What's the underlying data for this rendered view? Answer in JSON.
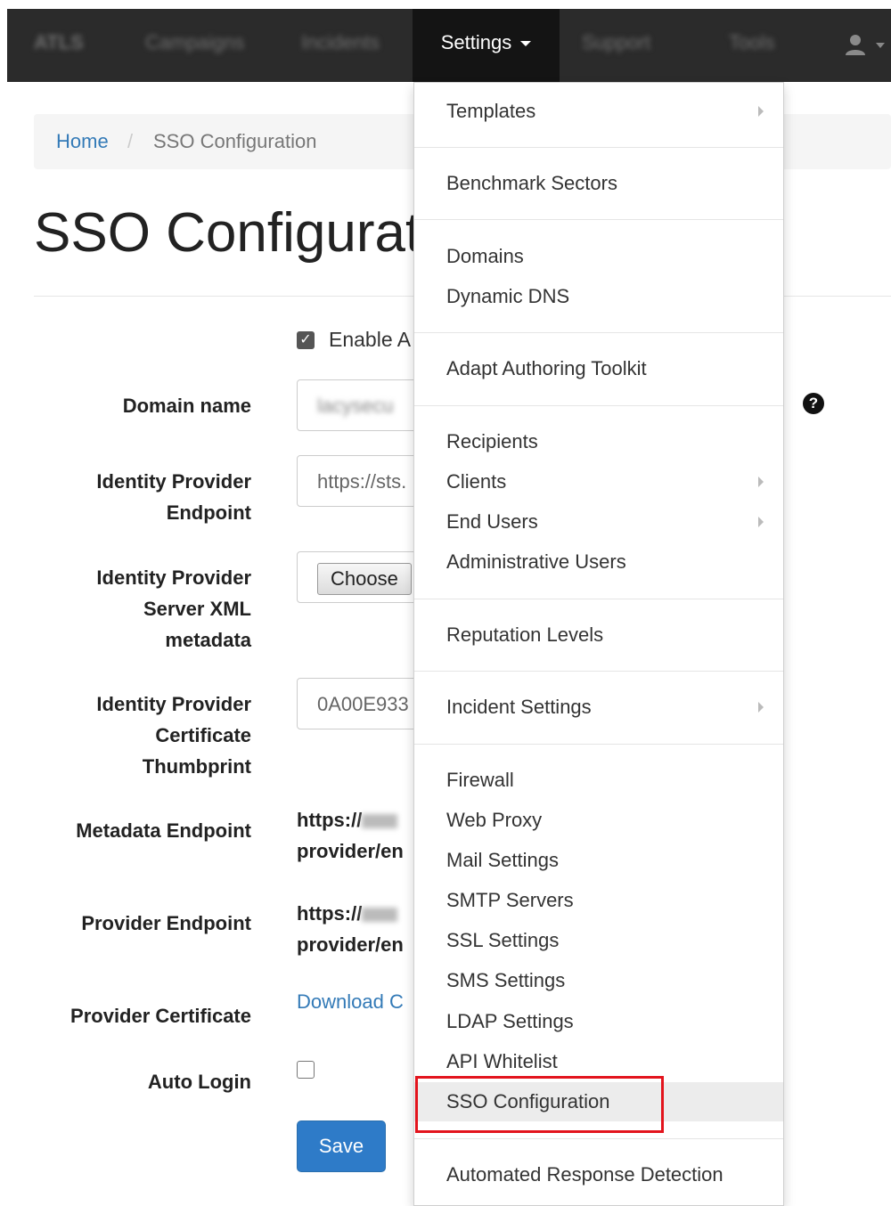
{
  "navbar": {
    "brand": "ATLS",
    "items": [
      "Campaigns",
      "Incidents",
      "Support",
      "Tools"
    ],
    "settings_label": "Settings"
  },
  "breadcrumb": {
    "home": "Home",
    "separator": "/",
    "current": "SSO Configuration"
  },
  "page": {
    "title": "SSO Configurat"
  },
  "form": {
    "enable_label": "Enable A",
    "domain_label": "Domain name",
    "idp_endpoint_label": [
      "Identity Provider",
      "Endpoint"
    ],
    "idp_endpoint_value": "https://sts.",
    "idp_metadata_label": [
      "Identity Provider",
      "Server XML",
      "metadata"
    ],
    "choose_file": "Choose",
    "idp_thumb_label": [
      "Identity Provider",
      "Certificate",
      "Thumbprint"
    ],
    "idp_thumb_value": "0A00E933",
    "metadata_endpoint_label": "Metadata Endpoint",
    "metadata_endpoint_lines": [
      "https://",
      "provider/en"
    ],
    "provider_endpoint_label": "Provider Endpoint",
    "provider_endpoint_lines": [
      "https://",
      "provider/en"
    ],
    "provider_cert_label": "Provider Certificate",
    "download_link": "Download C",
    "auto_login_label": "Auto Login",
    "save_button": "Save",
    "help_icon": "?"
  },
  "menu": {
    "templates": "Templates",
    "benchmark": "Benchmark Sectors",
    "domains": "Domains",
    "dynamic_dns": "Dynamic DNS",
    "adapt": "Adapt Authoring Toolkit",
    "recipients": "Recipients",
    "clients": "Clients",
    "end_users": "End Users",
    "admin_users": "Administrative Users",
    "reputation": "Reputation Levels",
    "incident_settings": "Incident Settings",
    "firewall": "Firewall",
    "web_proxy": "Web Proxy",
    "mail_settings": "Mail Settings",
    "smtp": "SMTP Servers",
    "ssl": "SSL Settings",
    "sms": "SMS Settings",
    "ldap": "LDAP Settings",
    "api": "API Whitelist",
    "sso": "SSO Configuration",
    "automated": "Automated Response Detection"
  },
  "colors": {
    "highlight": "#e3141d",
    "link": "#337ab7",
    "primary": "#2e7bc8"
  }
}
